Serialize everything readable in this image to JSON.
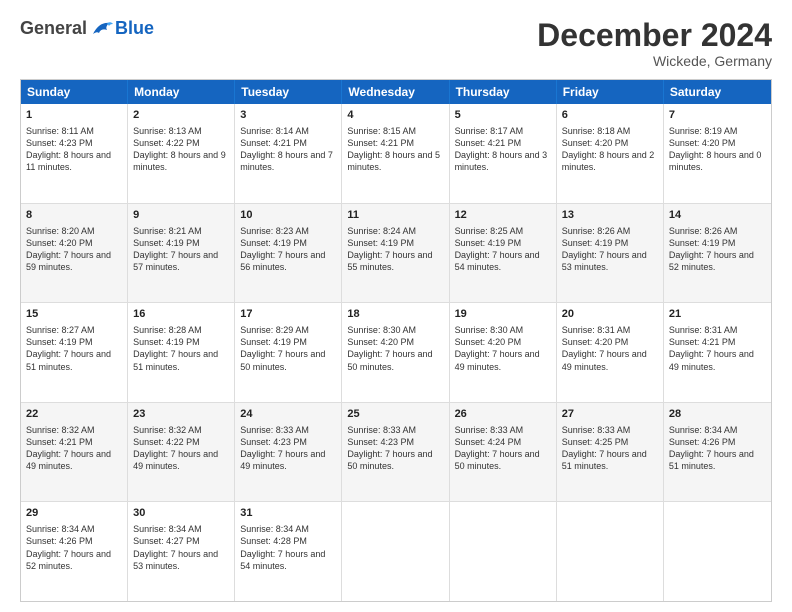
{
  "logo": {
    "general": "General",
    "blue": "Blue"
  },
  "title": "December 2024",
  "location": "Wickede, Germany",
  "days_of_week": [
    "Sunday",
    "Monday",
    "Tuesday",
    "Wednesday",
    "Thursday",
    "Friday",
    "Saturday"
  ],
  "weeks": [
    [
      {
        "day": "1",
        "sunrise": "8:11 AM",
        "sunset": "4:23 PM",
        "daylight": "8 hours and 11 minutes."
      },
      {
        "day": "2",
        "sunrise": "8:13 AM",
        "sunset": "4:22 PM",
        "daylight": "8 hours and 9 minutes."
      },
      {
        "day": "3",
        "sunrise": "8:14 AM",
        "sunset": "4:21 PM",
        "daylight": "8 hours and 7 minutes."
      },
      {
        "day": "4",
        "sunrise": "8:15 AM",
        "sunset": "4:21 PM",
        "daylight": "8 hours and 5 minutes."
      },
      {
        "day": "5",
        "sunrise": "8:17 AM",
        "sunset": "4:21 PM",
        "daylight": "8 hours and 3 minutes."
      },
      {
        "day": "6",
        "sunrise": "8:18 AM",
        "sunset": "4:20 PM",
        "daylight": "8 hours and 2 minutes."
      },
      {
        "day": "7",
        "sunrise": "8:19 AM",
        "sunset": "4:20 PM",
        "daylight": "8 hours and 0 minutes."
      }
    ],
    [
      {
        "day": "8",
        "sunrise": "8:20 AM",
        "sunset": "4:20 PM",
        "daylight": "7 hours and 59 minutes."
      },
      {
        "day": "9",
        "sunrise": "8:21 AM",
        "sunset": "4:19 PM",
        "daylight": "7 hours and 57 minutes."
      },
      {
        "day": "10",
        "sunrise": "8:23 AM",
        "sunset": "4:19 PM",
        "daylight": "7 hours and 56 minutes."
      },
      {
        "day": "11",
        "sunrise": "8:24 AM",
        "sunset": "4:19 PM",
        "daylight": "7 hours and 55 minutes."
      },
      {
        "day": "12",
        "sunrise": "8:25 AM",
        "sunset": "4:19 PM",
        "daylight": "7 hours and 54 minutes."
      },
      {
        "day": "13",
        "sunrise": "8:26 AM",
        "sunset": "4:19 PM",
        "daylight": "7 hours and 53 minutes."
      },
      {
        "day": "14",
        "sunrise": "8:26 AM",
        "sunset": "4:19 PM",
        "daylight": "7 hours and 52 minutes."
      }
    ],
    [
      {
        "day": "15",
        "sunrise": "8:27 AM",
        "sunset": "4:19 PM",
        "daylight": "7 hours and 51 minutes."
      },
      {
        "day": "16",
        "sunrise": "8:28 AM",
        "sunset": "4:19 PM",
        "daylight": "7 hours and 51 minutes."
      },
      {
        "day": "17",
        "sunrise": "8:29 AM",
        "sunset": "4:19 PM",
        "daylight": "7 hours and 50 minutes."
      },
      {
        "day": "18",
        "sunrise": "8:30 AM",
        "sunset": "4:20 PM",
        "daylight": "7 hours and 50 minutes."
      },
      {
        "day": "19",
        "sunrise": "8:30 AM",
        "sunset": "4:20 PM",
        "daylight": "7 hours and 49 minutes."
      },
      {
        "day": "20",
        "sunrise": "8:31 AM",
        "sunset": "4:20 PM",
        "daylight": "7 hours and 49 minutes."
      },
      {
        "day": "21",
        "sunrise": "8:31 AM",
        "sunset": "4:21 PM",
        "daylight": "7 hours and 49 minutes."
      }
    ],
    [
      {
        "day": "22",
        "sunrise": "8:32 AM",
        "sunset": "4:21 PM",
        "daylight": "7 hours and 49 minutes."
      },
      {
        "day": "23",
        "sunrise": "8:32 AM",
        "sunset": "4:22 PM",
        "daylight": "7 hours and 49 minutes."
      },
      {
        "day": "24",
        "sunrise": "8:33 AM",
        "sunset": "4:23 PM",
        "daylight": "7 hours and 49 minutes."
      },
      {
        "day": "25",
        "sunrise": "8:33 AM",
        "sunset": "4:23 PM",
        "daylight": "7 hours and 50 minutes."
      },
      {
        "day": "26",
        "sunrise": "8:33 AM",
        "sunset": "4:24 PM",
        "daylight": "7 hours and 50 minutes."
      },
      {
        "day": "27",
        "sunrise": "8:33 AM",
        "sunset": "4:25 PM",
        "daylight": "7 hours and 51 minutes."
      },
      {
        "day": "28",
        "sunrise": "8:34 AM",
        "sunset": "4:26 PM",
        "daylight": "7 hours and 51 minutes."
      }
    ],
    [
      {
        "day": "29",
        "sunrise": "8:34 AM",
        "sunset": "4:26 PM",
        "daylight": "7 hours and 52 minutes."
      },
      {
        "day": "30",
        "sunrise": "8:34 AM",
        "sunset": "4:27 PM",
        "daylight": "7 hours and 53 minutes."
      },
      {
        "day": "31",
        "sunrise": "8:34 AM",
        "sunset": "4:28 PM",
        "daylight": "7 hours and 54 minutes."
      },
      null,
      null,
      null,
      null
    ]
  ]
}
